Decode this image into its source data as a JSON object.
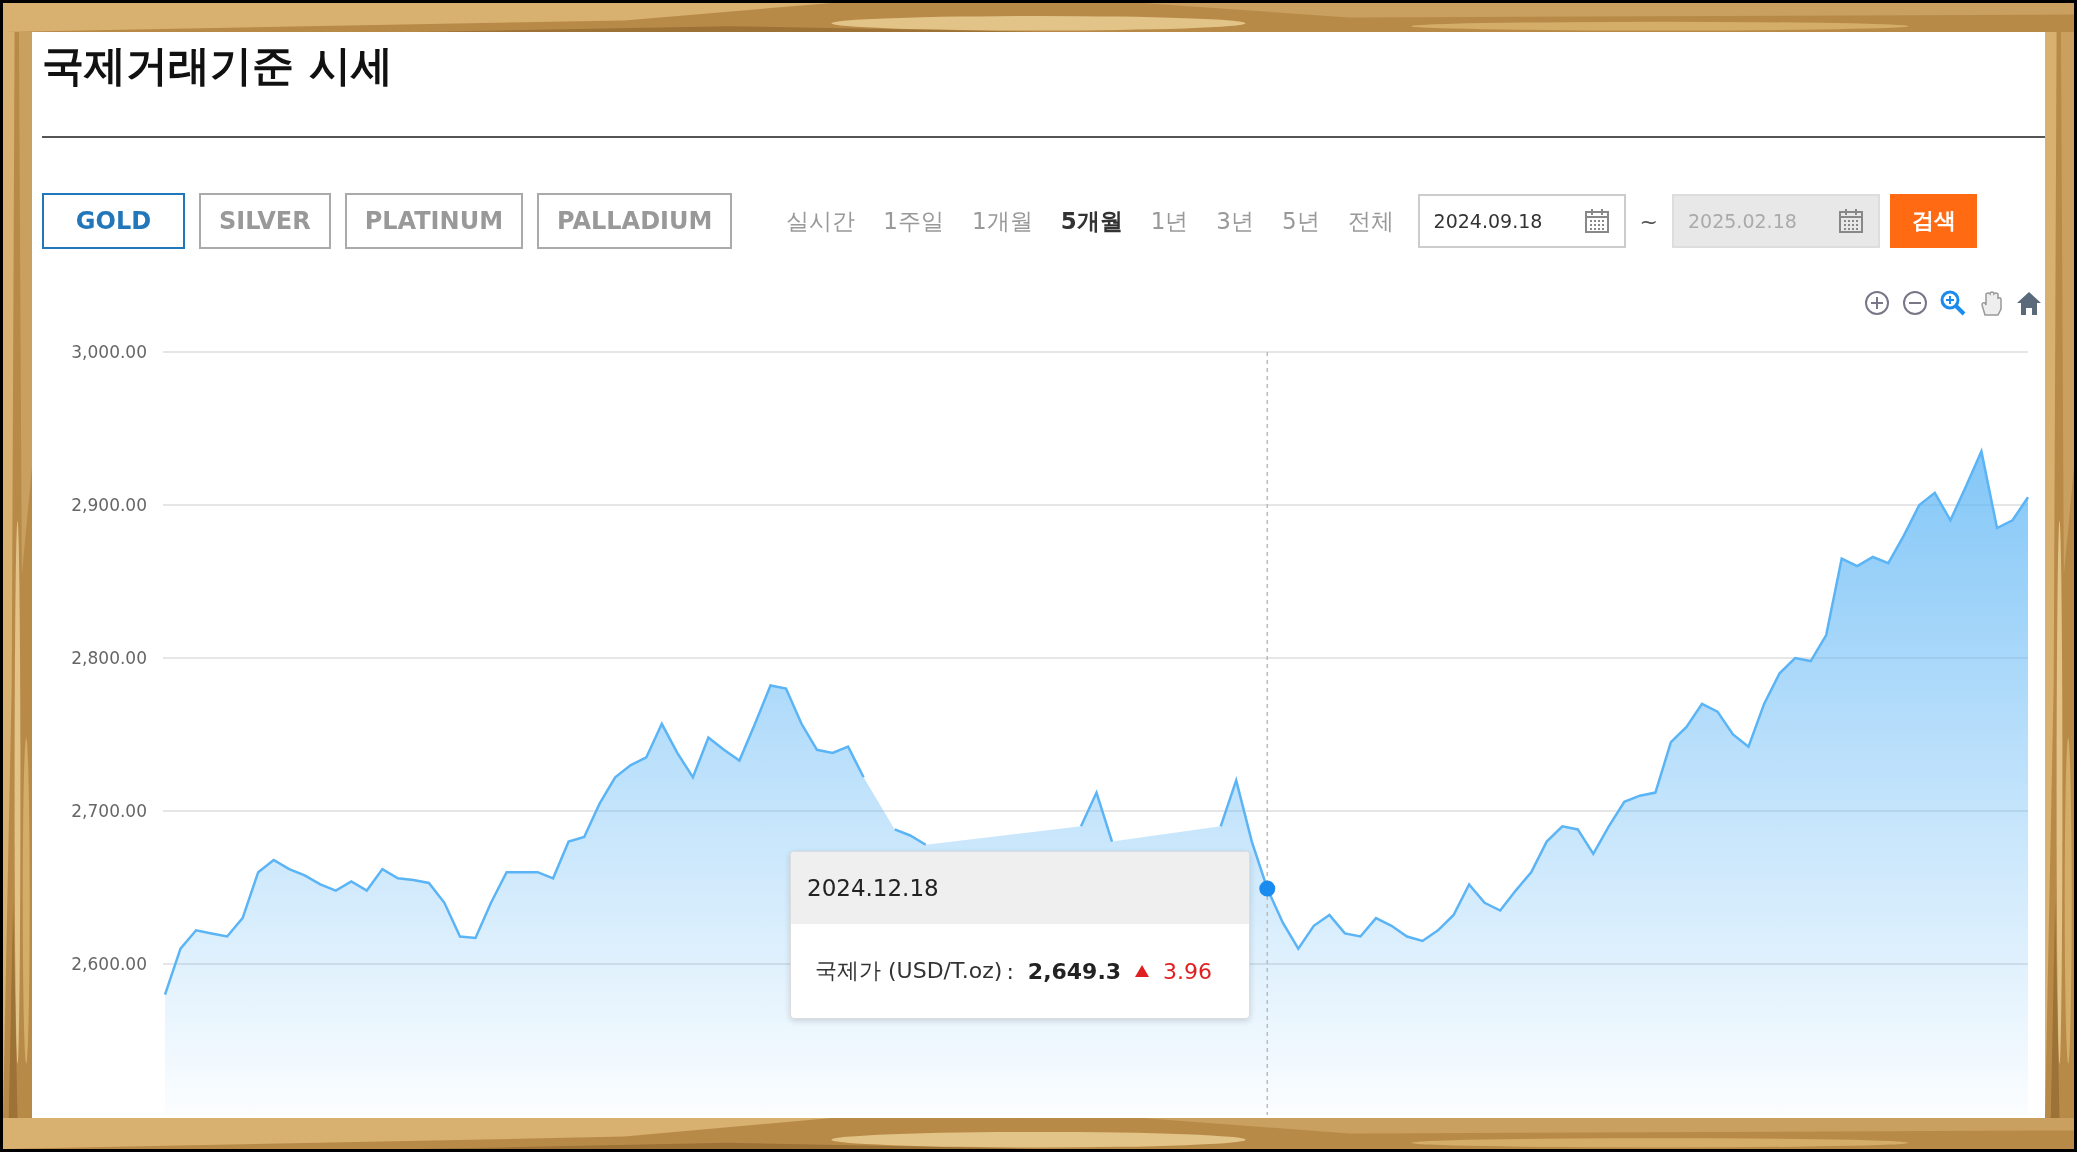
{
  "title": "국제거래기준 시세",
  "metals": [
    {
      "label": "GOLD",
      "selected": true
    },
    {
      "label": "SILVER",
      "selected": false
    },
    {
      "label": "PLATINUM",
      "selected": false
    },
    {
      "label": "PALLADIUM",
      "selected": false
    }
  ],
  "periods": [
    {
      "label": "실시간",
      "selected": false
    },
    {
      "label": "1주일",
      "selected": false
    },
    {
      "label": "1개월",
      "selected": false
    },
    {
      "label": "5개월",
      "selected": true
    },
    {
      "label": "1년",
      "selected": false
    },
    {
      "label": "3년",
      "selected": false
    },
    {
      "label": "5년",
      "selected": false
    },
    {
      "label": "전체",
      "selected": false
    }
  ],
  "date_from": {
    "value": "2024.09.18",
    "disabled": false
  },
  "separator": "~",
  "date_to": {
    "value": "2025.02.18",
    "disabled": true
  },
  "search_button": "검색",
  "chart": {
    "chart_data": {
      "type": "area",
      "ylim": [
        2500,
        3000
      ],
      "grid": true,
      "yticks": [
        {
          "value": 2600,
          "label": "2,600.00"
        },
        {
          "value": 2700,
          "label": "2,700.00"
        },
        {
          "value": 2800,
          "label": "2,800.00"
        },
        {
          "value": 2900,
          "label": "2,900.00"
        },
        {
          "value": 3000,
          "label": "3,000.00"
        }
      ],
      "series": [
        {
          "name": "국제가 (USD/T.oz)",
          "color": "#5ab4f5",
          "values": [
            2580,
            2610,
            2622,
            2620,
            2618,
            2630,
            2660,
            2668,
            2662,
            2658,
            2652,
            2648,
            2654,
            2648,
            2662,
            2656,
            2655,
            2653,
            2640,
            2618,
            2617,
            2640,
            2660,
            2660,
            2660,
            2656,
            2680,
            2683,
            2705,
            2722,
            2730,
            2735,
            2757,
            2738,
            2722,
            2748,
            2740,
            2733,
            2757,
            2782,
            2780,
            2757,
            2740,
            2738,
            2742,
            2722,
            null,
            2688,
            2684,
            2678,
            null,
            null,
            null,
            null,
            null,
            null,
            null,
            null,
            null,
            2690,
            2712,
            2680,
            null,
            null,
            null,
            null,
            null,
            null,
            2690,
            2720,
            2680,
            2649.3,
            2627,
            2610,
            2625,
            2632,
            2620,
            2618,
            2630,
            2625,
            2618,
            2615,
            2622,
            2632,
            2652,
            2640,
            2635,
            2648,
            2660,
            2680,
            2690,
            2688,
            2672,
            2690,
            2706,
            2710,
            2712,
            2745,
            2755,
            2770,
            2765,
            2750,
            2742,
            2770,
            2790,
            2800,
            2798,
            2815,
            2865,
            2860,
            2866,
            2862,
            2880,
            2900,
            2908,
            2890,
            2912,
            2935,
            2885,
            2890,
            2905
          ]
        }
      ]
    },
    "tooltip": {
      "date": "2024.12.18",
      "separator": ":",
      "value": "2,649.3",
      "rising": true,
      "change": "3.96"
    }
  }
}
